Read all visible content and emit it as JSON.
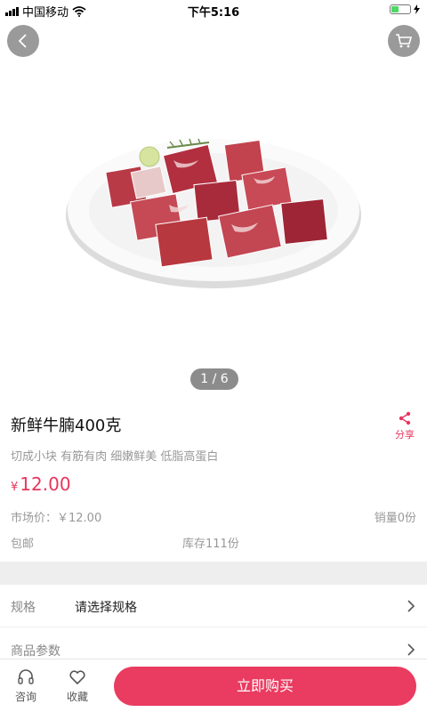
{
  "status_bar": {
    "carrier": "中国移动",
    "time": "下午5:16"
  },
  "gallery": {
    "pager": "1 / 6"
  },
  "product": {
    "title": "新鲜牛腩400克",
    "share_label": "分享",
    "subtitle": "切成小块 有筋有肉 细嫩鲜美 低脂高蛋白",
    "price_symbol": "¥",
    "price": "12.00",
    "market_price": "市场价：￥12.00",
    "sales": "销量0份",
    "shipping": "包邮",
    "stock": "库存111份"
  },
  "spec": {
    "label": "规格",
    "value": "请选择规格"
  },
  "params": {
    "label": "商品参数"
  },
  "bottom_bar": {
    "consult_label": "咨询",
    "favorite_label": "收藏",
    "buy_label": "立即购买"
  },
  "colors": {
    "accent": "#e8365d",
    "muted_text": "#999999"
  },
  "icons": [
    "back-icon",
    "cart-icon",
    "share-icon",
    "chevron-right-icon",
    "headset-icon",
    "heart-icon",
    "wifi-icon",
    "battery-icon",
    "signal-icon"
  ]
}
